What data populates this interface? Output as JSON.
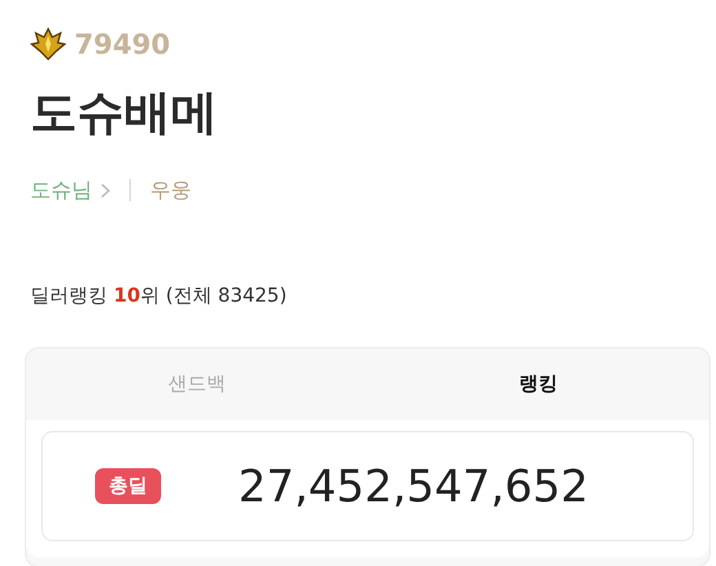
{
  "profile": {
    "score": "79490",
    "name": "도슈배메",
    "guild": "도슈님",
    "job": "우웅"
  },
  "rank_line": "딜러랭킹 **10**위 (전체 83425)",
  "tabs": [
    {
      "label": "샌드백",
      "selected": false
    },
    {
      "label": "랭킹",
      "selected": true
    }
  ],
  "stat": {
    "badge": "총딜",
    "value": "27,452,547,652"
  }
}
